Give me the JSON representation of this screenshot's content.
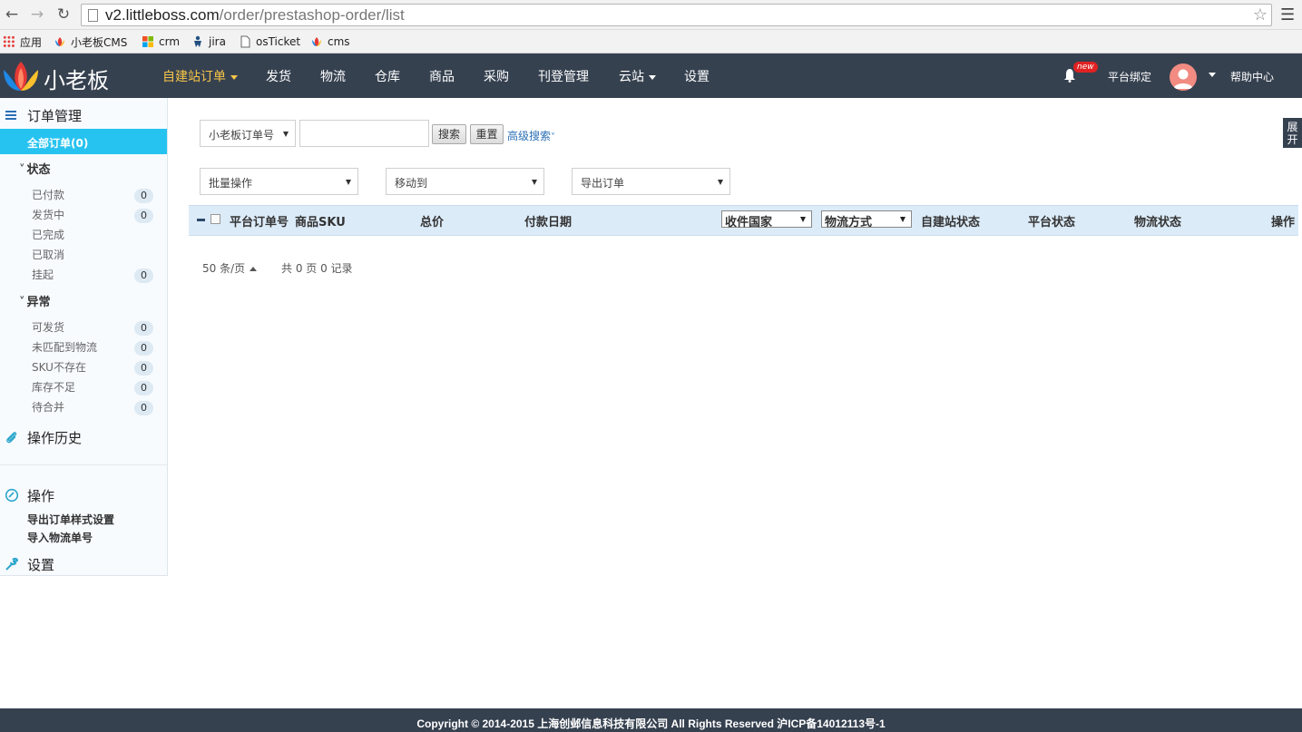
{
  "browser": {
    "url_host": "v2.littleboss.com",
    "url_path": "/order/prestashop-order/list",
    "bookmarks": [
      {
        "label": "应用",
        "icon": "apps-grid-icon"
      },
      {
        "label": "小老板CMS",
        "icon": "lotus-icon"
      },
      {
        "label": "crm",
        "icon": "windows-icon"
      },
      {
        "label": "jira",
        "icon": "jira-icon"
      },
      {
        "label": "osTicket",
        "icon": "page-icon"
      },
      {
        "label": "cms",
        "icon": "lotus-icon"
      }
    ]
  },
  "header": {
    "logo_text": "小老板",
    "nav": [
      {
        "label": "自建站订单",
        "dropdown": true,
        "active": true
      },
      {
        "label": "发货"
      },
      {
        "label": "物流"
      },
      {
        "label": "仓库"
      },
      {
        "label": "商品"
      },
      {
        "label": "采购"
      },
      {
        "label": "刊登管理"
      },
      {
        "label": "云站",
        "dropdown": true
      },
      {
        "label": "设置"
      }
    ],
    "new_badge": "new",
    "platform_bind": "平台绑定",
    "help_center": "帮助中心",
    "accent_color": "#f7c548",
    "bg_color": "#364150"
  },
  "sidebar": {
    "order_mgmt": "订单管理",
    "all_orders": "全部订单(0)",
    "status_group": "状态",
    "status_items": [
      {
        "label": "已付款",
        "count": "0"
      },
      {
        "label": "发货中",
        "count": "0"
      },
      {
        "label": "已完成",
        "count": null
      },
      {
        "label": "已取消",
        "count": null
      },
      {
        "label": "挂起",
        "count": "0"
      }
    ],
    "exception_group": "异常",
    "exception_items": [
      {
        "label": "可发货",
        "count": "0"
      },
      {
        "label": "未匹配到物流",
        "count": "0"
      },
      {
        "label": "SKU不存在",
        "count": "0"
      },
      {
        "label": "库存不足",
        "count": "0"
      },
      {
        "label": "待合并",
        "count": "0"
      }
    ],
    "history": "操作历史",
    "operations": "操作",
    "op_links": [
      "导出订单样式设置",
      "导入物流单号"
    ],
    "settings": "设置",
    "active_color": "#27c3f0"
  },
  "search": {
    "field_select": "小老板订单号",
    "search_btn": "搜索",
    "reset_btn": "重置",
    "advanced": "高级搜索"
  },
  "actions": {
    "batch": "批量操作",
    "move_to": "移动到",
    "export": "导出订单"
  },
  "table": {
    "col_platform_order": "平台订单号",
    "col_sku": "商品SKU",
    "col_total": "总价",
    "col_pay_date": "付款日期",
    "col_country": "收件国家",
    "col_shipping": "物流方式",
    "col_site_status": "自建站状态",
    "col_platform_status": "平台状态",
    "col_logistics_status": "物流状态",
    "col_actions": "操作"
  },
  "pager": {
    "per_page": "50 条/页",
    "summary": "共 0 页 0 记录"
  },
  "expand_tab": "展开",
  "footer": "Copyright © 2014-2015 上海创邺信息科技有限公司 All Rights Reserved 沪ICP备14012113号-1"
}
